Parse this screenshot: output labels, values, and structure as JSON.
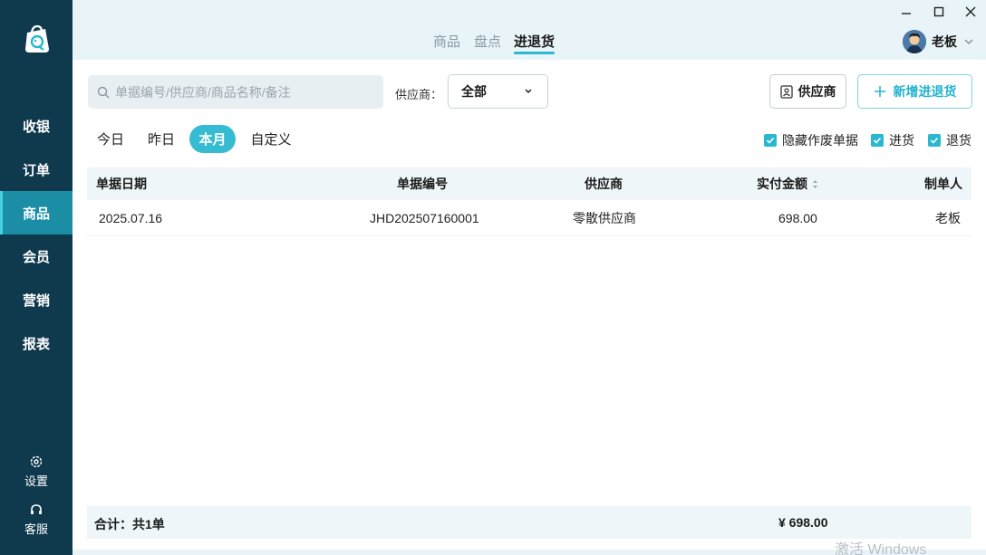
{
  "sidebar": {
    "nav": [
      {
        "label": "收银"
      },
      {
        "label": "订单"
      },
      {
        "label": "商品"
      },
      {
        "label": "会员"
      },
      {
        "label": "营销"
      },
      {
        "label": "报表"
      }
    ],
    "active_index": 2,
    "settings_label": "设置",
    "service_label": "客服"
  },
  "topbar": {
    "tabs": [
      {
        "label": "商品"
      },
      {
        "label": "盘点"
      },
      {
        "label": "进退货"
      }
    ],
    "active_tab": 2,
    "user_name": "老板"
  },
  "toolbar": {
    "search_placeholder": "单据编号/供应商/商品名称/备注",
    "supplier_label": "供应商：",
    "supplier_value": "全部",
    "supplier_button": "供应商",
    "add_button": "新增进退货"
  },
  "filters": {
    "dates": [
      {
        "label": "今日"
      },
      {
        "label": "昨日"
      },
      {
        "label": "本月"
      },
      {
        "label": "自定义"
      }
    ],
    "active_date": 2,
    "checkboxes": [
      {
        "label": "隐藏作废单据",
        "checked": true
      },
      {
        "label": "进货",
        "checked": true
      },
      {
        "label": "退货",
        "checked": true
      }
    ]
  },
  "table": {
    "columns": [
      "单据日期",
      "单据编号",
      "供应商",
      "实付金额",
      "制单人"
    ],
    "rows": [
      {
        "date": "2025.07.16",
        "number": "JHD202507160001",
        "supplier": "零散供应商",
        "amount": "698.00",
        "maker": "老板"
      }
    ]
  },
  "footer": {
    "total_label": "合计：共1单",
    "total_amount": "¥  698.00"
  },
  "watermark": "激活 Windows",
  "colors": {
    "sidebar": "#0f3a4e",
    "accent": "#29b8d0",
    "active_nav": "#1b8ea6"
  }
}
